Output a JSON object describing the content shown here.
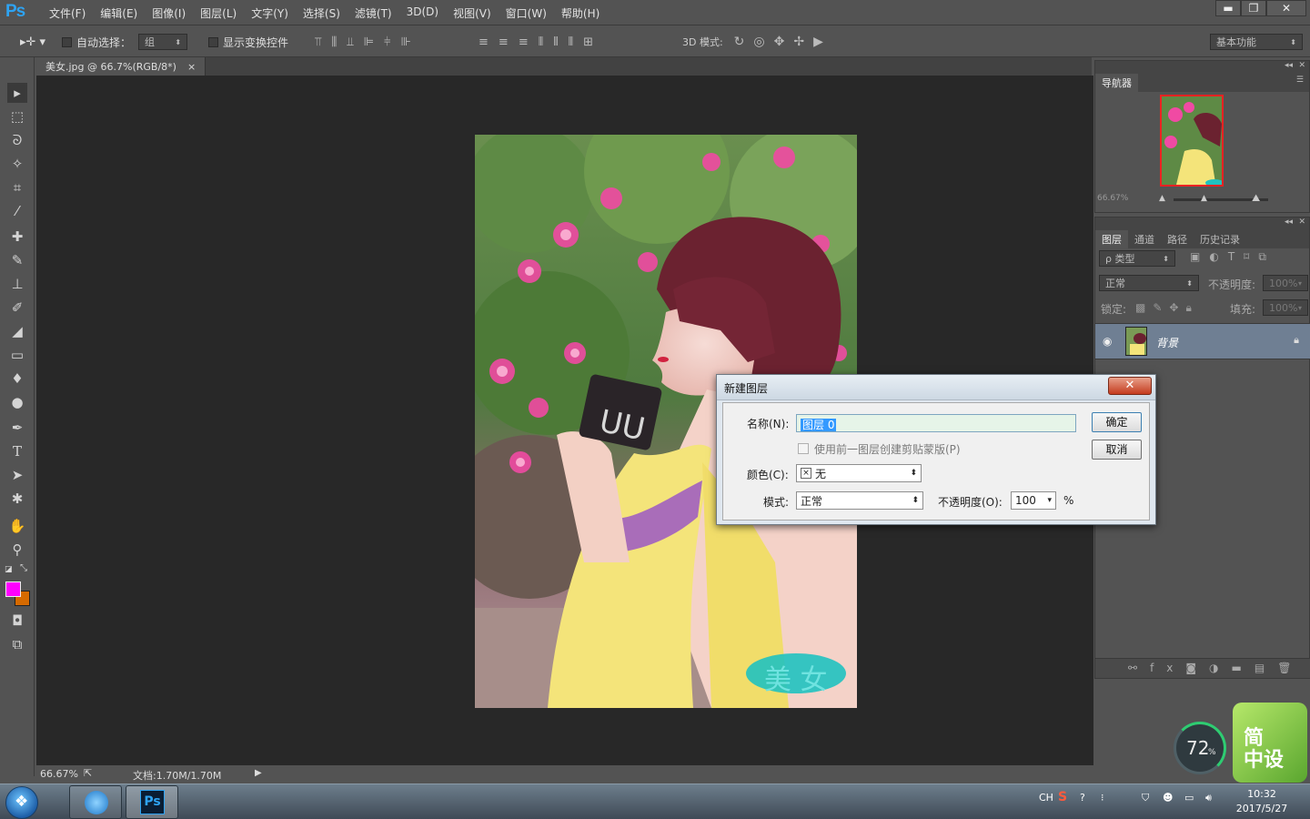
{
  "app": {
    "logo": "Ps"
  },
  "menu": [
    "文件(F)",
    "编辑(E)",
    "图像(I)",
    "图层(L)",
    "文字(Y)",
    "选择(S)",
    "滤镜(T)",
    "3D(D)",
    "视图(V)",
    "窗口(W)",
    "帮助(H)"
  ],
  "window_buttons": {
    "minimize": "▬",
    "restore": "❐",
    "close": "✕"
  },
  "options": {
    "auto_select_label": "自动选择：",
    "auto_select_value": "组",
    "show_transform_label": "显示变换控件",
    "mode_3d_label": "3D 模式:",
    "workspace": "基本功能"
  },
  "document": {
    "tab_title": "美女.jpg @ 66.7%(RGB/8*)",
    "tab_close": "×"
  },
  "watermark": "美 女",
  "status": {
    "zoom": "66.67%",
    "doc_size": "文档:1.70M/1.70M"
  },
  "colors": {
    "foreground": "#ff00ff",
    "background": "#d66a00"
  },
  "navigator": {
    "title": "导航器",
    "zoom": "66.67%"
  },
  "layers_panel": {
    "tabs": [
      "图层",
      "通道",
      "路径",
      "历史记录"
    ],
    "filter": "ρ 类型",
    "blend_mode": "正常",
    "opacity_label": "不透明度:",
    "opacity_value": "100%",
    "lock_label": "锁定:",
    "fill_label": "填充:",
    "fill_value": "100%",
    "layer_name": "背景"
  },
  "dialog": {
    "title": "新建图层",
    "close": "✕",
    "name_label": "名称(N):",
    "name_value": "图层 0",
    "clip_label": "使用前一图层创建剪贴蒙版(P)",
    "color_label": "颜色(C):",
    "color_value": "无",
    "mode_label": "模式:",
    "mode_value": "正常",
    "opacity_label": "不透明度(O):",
    "opacity_value": "100",
    "opacity_unit": "%",
    "ok": "确定",
    "cancel": "取消"
  },
  "widget": {
    "percent": "72",
    "percent_unit": "%",
    "logo_line1": "简",
    "logo_line2": "中设"
  },
  "taskbar": {
    "lang": "CH",
    "time": "10:32",
    "date": "2017/5/27",
    "ps_label": "Ps"
  }
}
